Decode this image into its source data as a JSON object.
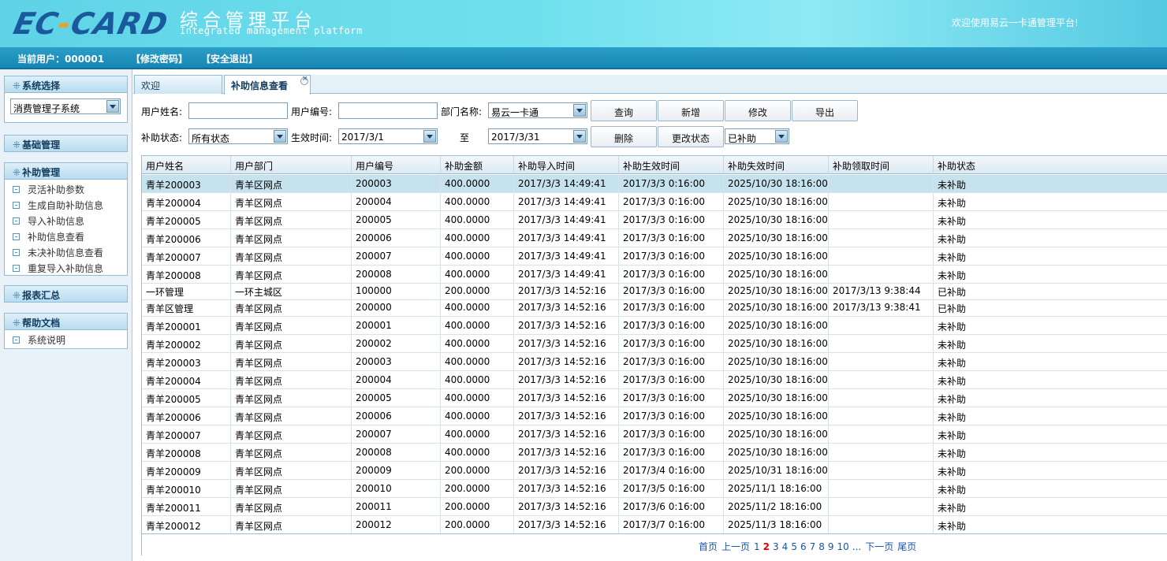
{
  "header": {
    "logo_text": "EC-CARD",
    "title_cn": "综合管理平台",
    "title_en": "Integrated management platform",
    "welcome": "欢迎使用易云一卡通管理平台!"
  },
  "userbar": {
    "current_user": "当前用户：000001",
    "change_password": "【修改密码】",
    "logout": "【安全退出】"
  },
  "sidebar": {
    "system_select": {
      "title": "系统选择",
      "selected": "消费管理子系统"
    },
    "basic": {
      "title": "基础管理"
    },
    "subsidy": {
      "title": "补助管理",
      "items": [
        "灵活补助参数",
        "生成自助补助信息",
        "导入补助信息",
        "补助信息查看",
        "未决补助信息查看",
        "重复导入补助信息"
      ]
    },
    "report": {
      "title": "报表汇总"
    },
    "help": {
      "title": "帮助文档",
      "items": [
        "系统说明"
      ]
    }
  },
  "tabs": {
    "welcome": "欢迎",
    "current": "补助信息查看"
  },
  "form": {
    "user_name_label": "用户姓名:",
    "user_name_value": "",
    "user_id_label": "用户编号:",
    "user_id_value": "",
    "dept_label": "部门名称:",
    "dept_value": "易云一卡通",
    "status_label": "补助状态:",
    "status_value": "所有状态",
    "effective_label": "生效时间:",
    "date_from": "2017/3/1",
    "to_label": "至",
    "date_to": "2017/3/31",
    "filter_value": "已补助",
    "buttons": {
      "query": "查询",
      "add": "新增",
      "edit": "修改",
      "export": "导出",
      "delete": "删除",
      "change_status": "更改状态"
    }
  },
  "table": {
    "columns": [
      "用户姓名",
      "用户部门",
      "用户编号",
      "补助金额",
      "补助导入时间",
      "补助生效时间",
      "补助失效时间",
      "补助领取时间",
      "补助状态"
    ],
    "rows": [
      [
        "青羊200003",
        "青羊区网点",
        "200003",
        "400.0000",
        "2017/3/3 14:49:41",
        "2017/3/3 0:16:00",
        "2025/10/30 18:16:00",
        "",
        "未补助"
      ],
      [
        "青羊200004",
        "青羊区网点",
        "200004",
        "400.0000",
        "2017/3/3 14:49:41",
        "2017/3/3 0:16:00",
        "2025/10/30 18:16:00",
        "",
        "未补助"
      ],
      [
        "青羊200005",
        "青羊区网点",
        "200005",
        "400.0000",
        "2017/3/3 14:49:41",
        "2017/3/3 0:16:00",
        "2025/10/30 18:16:00",
        "",
        "未补助"
      ],
      [
        "青羊200006",
        "青羊区网点",
        "200006",
        "400.0000",
        "2017/3/3 14:49:41",
        "2017/3/3 0:16:00",
        "2025/10/30 18:16:00",
        "",
        "未补助"
      ],
      [
        "青羊200007",
        "青羊区网点",
        "200007",
        "400.0000",
        "2017/3/3 14:49:41",
        "2017/3/3 0:16:00",
        "2025/10/30 18:16:00",
        "",
        "未补助"
      ],
      [
        "青羊200008",
        "青羊区网点",
        "200008",
        "400.0000",
        "2017/3/3 14:49:41",
        "2017/3/3 0:16:00",
        "2025/10/30 18:16:00",
        "",
        "未补助"
      ],
      [
        "一环管理",
        "一环主城区",
        "100000",
        "200.0000",
        "2017/3/3 14:52:16",
        "2017/3/3 0:16:00",
        "2025/10/30 18:16:00",
        "2017/3/13 9:38:44",
        "已补助"
      ],
      [
        "青羊区管理",
        "青羊区网点",
        "200000",
        "400.0000",
        "2017/3/3 14:52:16",
        "2017/3/3 0:16:00",
        "2025/10/30 18:16:00",
        "2017/3/13 9:38:41",
        "已补助"
      ],
      [
        "青羊200001",
        "青羊区网点",
        "200001",
        "400.0000",
        "2017/3/3 14:52:16",
        "2017/3/3 0:16:00",
        "2025/10/30 18:16:00",
        "",
        "未补助"
      ],
      [
        "青羊200002",
        "青羊区网点",
        "200002",
        "400.0000",
        "2017/3/3 14:52:16",
        "2017/3/3 0:16:00",
        "2025/10/30 18:16:00",
        "",
        "未补助"
      ],
      [
        "青羊200003",
        "青羊区网点",
        "200003",
        "400.0000",
        "2017/3/3 14:52:16",
        "2017/3/3 0:16:00",
        "2025/10/30 18:16:00",
        "",
        "未补助"
      ],
      [
        "青羊200004",
        "青羊区网点",
        "200004",
        "400.0000",
        "2017/3/3 14:52:16",
        "2017/3/3 0:16:00",
        "2025/10/30 18:16:00",
        "",
        "未补助"
      ],
      [
        "青羊200005",
        "青羊区网点",
        "200005",
        "400.0000",
        "2017/3/3 14:52:16",
        "2017/3/3 0:16:00",
        "2025/10/30 18:16:00",
        "",
        "未补助"
      ],
      [
        "青羊200006",
        "青羊区网点",
        "200006",
        "400.0000",
        "2017/3/3 14:52:16",
        "2017/3/3 0:16:00",
        "2025/10/30 18:16:00",
        "",
        "未补助"
      ],
      [
        "青羊200007",
        "青羊区网点",
        "200007",
        "400.0000",
        "2017/3/3 14:52:16",
        "2017/3/3 0:16:00",
        "2025/10/30 18:16:00",
        "",
        "未补助"
      ],
      [
        "青羊200008",
        "青羊区网点",
        "200008",
        "400.0000",
        "2017/3/3 14:52:16",
        "2017/3/3 0:16:00",
        "2025/10/30 18:16:00",
        "",
        "未补助"
      ],
      [
        "青羊200009",
        "青羊区网点",
        "200009",
        "200.0000",
        "2017/3/3 14:52:16",
        "2017/3/4 0:16:00",
        "2025/10/31 18:16:00",
        "",
        "未补助"
      ],
      [
        "青羊200010",
        "青羊区网点",
        "200010",
        "200.0000",
        "2017/3/3 14:52:16",
        "2017/3/5 0:16:00",
        "2025/11/1 18:16:00",
        "",
        "未补助"
      ],
      [
        "青羊200011",
        "青羊区网点",
        "200011",
        "200.0000",
        "2017/3/3 14:52:16",
        "2017/3/6 0:16:00",
        "2025/11/2 18:16:00",
        "",
        "未补助"
      ],
      [
        "青羊200012",
        "青羊区网点",
        "200012",
        "200.0000",
        "2017/3/3 14:52:16",
        "2017/3/7 0:16:00",
        "2025/11/3 18:16:00",
        "",
        "未补助"
      ]
    ]
  },
  "pager": {
    "first": "首页",
    "prev": "上一页",
    "pages": [
      "1",
      "2",
      "3",
      "4",
      "5",
      "6",
      "7",
      "8",
      "9",
      "10"
    ],
    "current": "2",
    "ellipsis": "...",
    "next": "下一页",
    "last": "尾页"
  }
}
